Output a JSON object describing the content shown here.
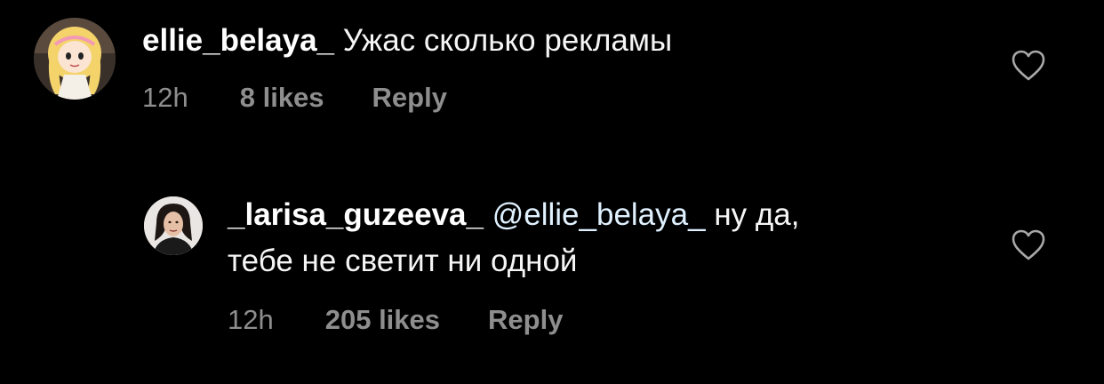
{
  "comments": [
    {
      "username": "ellie_belaya_",
      "text": "Ужас сколько рекламы",
      "time": "12h",
      "likes": "8 likes",
      "reply": "Reply",
      "avatar_icon": "cartoon-girl-avatar",
      "like_icon": "heart-outline-icon"
    },
    {
      "username": "_larisa_guzeeva_",
      "mention": "@ellie_belaya_",
      "text_line1": "ну да,",
      "text_line2": "тебе не светит ни одной",
      "time": "12h",
      "likes": "205 likes",
      "reply": "Reply",
      "avatar_icon": "woman-portrait-avatar",
      "like_icon": "heart-outline-icon"
    }
  ],
  "colors": {
    "background": "#000000",
    "text": "#f5f5f5",
    "meta": "#8e8e8e",
    "mention": "#e0f1ff"
  }
}
